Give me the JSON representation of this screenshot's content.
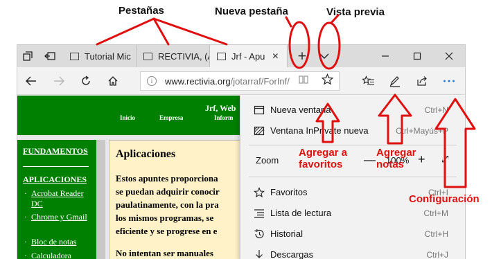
{
  "annotations": {
    "tabs_label": "Pestañas",
    "new_tab_label": "Nueva pestaña",
    "preview_label": "Vista previa",
    "favorites_label": "Agregar a favoritos",
    "notes_label": "Agregar notas",
    "settings_label": "Configuración",
    "accent_color": "#e01010"
  },
  "tabs": [
    {
      "title": "Tutorial Mic",
      "active": false
    },
    {
      "title": "RECTIVIA, (A",
      "active": false
    },
    {
      "title": "Jrf - Apu",
      "active": true
    }
  ],
  "tabbar": {
    "new_tab_symbol": "+",
    "preview_symbol": "⌄",
    "close_symbol": "✕"
  },
  "window_controls": {
    "minimize": "—",
    "maximize": "☐",
    "close": "✕"
  },
  "address_bar": {
    "host": "www.rectivia.org",
    "path": "/jotarraf/ForInf/"
  },
  "website": {
    "header_title": "Jrf, Web",
    "nav": [
      "Inicio",
      "Empresa",
      "Inform"
    ],
    "sidebar": {
      "sections": [
        "FUNDAMENTOS",
        "APLICACIONES"
      ],
      "items": [
        {
          "bullet": "·",
          "label": "Acrobat Reader DC"
        },
        {
          "bullet": "·",
          "label": "Chrome y Gmail"
        },
        {
          "bullet": "·",
          "label": "Bloc de notas"
        },
        {
          "bullet": "·",
          "label": "Calculadora"
        }
      ]
    },
    "main": {
      "title": "Aplicaciones",
      "lines": [
        "Estos apuntes proporciona",
        "se puedan adquirir conocir",
        "paulatinamente, con la pra",
        "los mismos programas, se",
        "eficiente y se progrese en e",
        "No intentan ser manuales"
      ]
    }
  },
  "menu": {
    "items_top": [
      {
        "icon": "new-window-icon",
        "label": "Nueva ventana",
        "shortcut": "Ctrl+N"
      },
      {
        "icon": "inprivate-window-icon",
        "label": "Ventana InPrivate nueva",
        "shortcut": "Ctrl+Mayús+P"
      }
    ],
    "zoom": {
      "label": "Zoom",
      "minus": "—",
      "value": "100%",
      "plus": "+",
      "fullscreen": "⤢"
    },
    "items_bottom": [
      {
        "icon": "favorites-star-icon",
        "label": "Favoritos",
        "shortcut": "Ctrl+I"
      },
      {
        "icon": "reading-list-icon",
        "label": "Lista de lectura",
        "shortcut": "Ctrl+M"
      },
      {
        "icon": "history-icon",
        "label": "Historial",
        "shortcut": "Ctrl+H"
      },
      {
        "icon": "downloads-icon",
        "label": "Descargas",
        "shortcut": "Ctrl+J"
      }
    ]
  }
}
